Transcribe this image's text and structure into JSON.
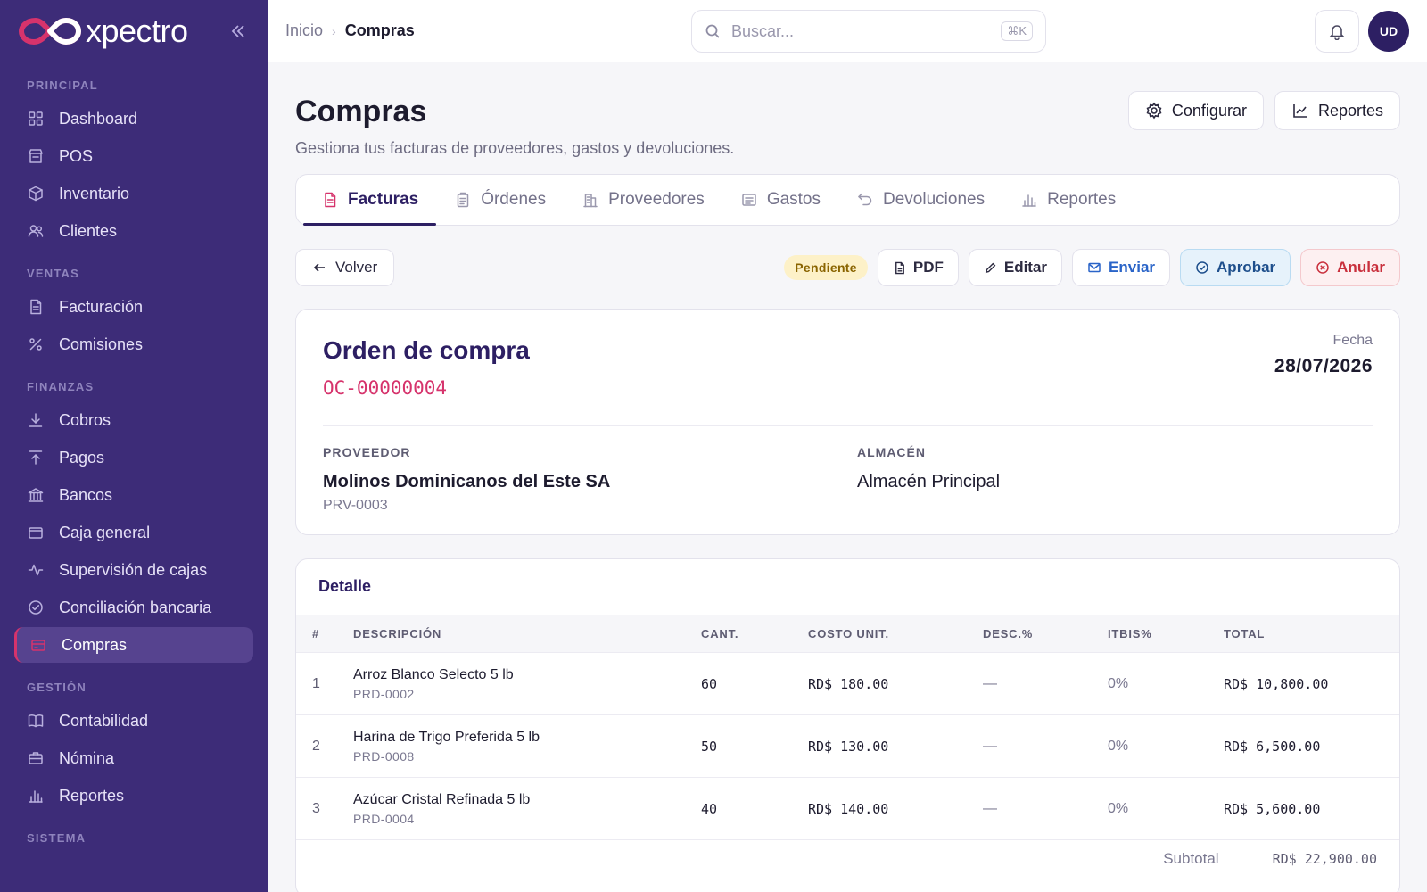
{
  "brand": {
    "name": "xpectro",
    "colors": {
      "sidebar_bg": "#3d2c78",
      "accent": "#d6336c",
      "primary": "#2d1f63"
    }
  },
  "sidebar": {
    "sections": [
      {
        "title": "PRINCIPAL",
        "items": [
          {
            "label": "Dashboard",
            "icon": "grid-icon"
          },
          {
            "label": "POS",
            "icon": "store-icon"
          },
          {
            "label": "Inventario",
            "icon": "box-icon"
          },
          {
            "label": "Clientes",
            "icon": "users-icon"
          }
        ]
      },
      {
        "title": "VENTAS",
        "items": [
          {
            "label": "Facturación",
            "icon": "file-icon"
          },
          {
            "label": "Comisiones",
            "icon": "percent-icon"
          }
        ]
      },
      {
        "title": "FINANZAS",
        "items": [
          {
            "label": "Cobros",
            "icon": "download-icon"
          },
          {
            "label": "Pagos",
            "icon": "upload-icon"
          },
          {
            "label": "Bancos",
            "icon": "bank-icon"
          },
          {
            "label": "Caja general",
            "icon": "wallet-icon"
          },
          {
            "label": "Supervisión de cajas",
            "icon": "activity-icon"
          },
          {
            "label": "Conciliación bancaria",
            "icon": "check-circle-icon"
          },
          {
            "label": "Compras",
            "icon": "cart-icon",
            "active": true
          }
        ]
      },
      {
        "title": "GESTIÓN",
        "items": [
          {
            "label": "Contabilidad",
            "icon": "book-icon"
          },
          {
            "label": "Nómina",
            "icon": "briefcase-icon"
          },
          {
            "label": "Reportes",
            "icon": "bar-chart-icon"
          }
        ]
      },
      {
        "title": "SISTEMA",
        "items": []
      }
    ]
  },
  "topbar": {
    "breadcrumb": {
      "home": "Inicio",
      "current": "Compras"
    },
    "search": {
      "placeholder": "Buscar...",
      "shortcut": "⌘K"
    },
    "avatar_initials": "UD"
  },
  "page": {
    "title": "Compras",
    "subtitle": "Gestiona tus facturas de proveedores, gastos y devoluciones.",
    "actions": {
      "configure": "Configurar",
      "reports": "Reportes"
    }
  },
  "tabs": [
    {
      "label": "Facturas",
      "icon": "file-text-icon",
      "active": true
    },
    {
      "label": "Órdenes",
      "icon": "clipboard-icon"
    },
    {
      "label": "Proveedores",
      "icon": "building-icon"
    },
    {
      "label": "Gastos",
      "icon": "receipt-icon"
    },
    {
      "label": "Devoluciones",
      "icon": "undo-icon"
    },
    {
      "label": "Reportes",
      "icon": "bar-chart-icon"
    }
  ],
  "toolbar": {
    "back": "Volver",
    "status": "Pendiente",
    "pdf": "PDF",
    "edit": "Editar",
    "send": "Enviar",
    "approve": "Aprobar",
    "cancel": "Anular"
  },
  "order": {
    "title": "Orden de compra",
    "code": "OC-00000004",
    "date_label": "Fecha",
    "date": "28/07/2026",
    "supplier_label": "PROVEEDOR",
    "supplier_name": "Molinos Dominicanos del Este SA",
    "supplier_code": "PRV-0003",
    "warehouse_label": "ALMACÉN",
    "warehouse_name": "Almacén Principal"
  },
  "detail": {
    "title": "Detalle",
    "columns": [
      "#",
      "DESCRIPCIÓN",
      "CANT.",
      "COSTO UNIT.",
      "DESC.%",
      "ITBIS%",
      "TOTAL"
    ],
    "rows": [
      {
        "idx": "1",
        "name": "Arroz Blanco Selecto 5 lb",
        "code": "PRD-0002",
        "qty": "60",
        "cost": "RD$ 180.00",
        "disc": "—",
        "itbis": "0%",
        "total": "RD$ 10,800.00"
      },
      {
        "idx": "2",
        "name": "Harina de Trigo Preferida 5 lb",
        "code": "PRD-0008",
        "qty": "50",
        "cost": "RD$ 130.00",
        "disc": "—",
        "itbis": "0%",
        "total": "RD$ 6,500.00"
      },
      {
        "idx": "3",
        "name": "Azúcar Cristal Refinada 5 lb",
        "code": "PRD-0004",
        "qty": "40",
        "cost": "RD$ 140.00",
        "disc": "—",
        "itbis": "0%",
        "total": "RD$ 5,600.00"
      }
    ],
    "subtotal_label": "Subtotal",
    "subtotal_value": "RD$ 22,900.00"
  }
}
